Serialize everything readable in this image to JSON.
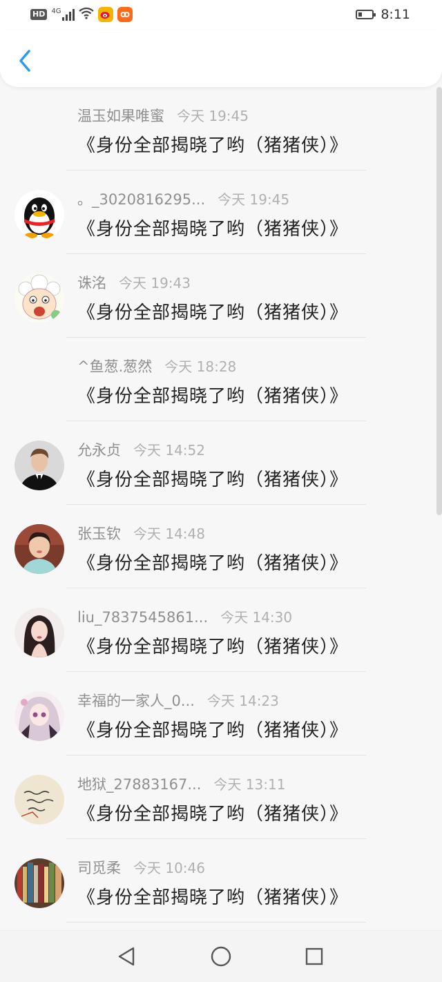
{
  "status_bar": {
    "hd": "HD",
    "network": "4G",
    "time": "8:11",
    "battery_level": 0.3
  },
  "header": {
    "back_icon": "chevron-left-icon",
    "accent_color": "#2b9de8"
  },
  "message_text": "《身份全部揭晓了哟（猪猪侠）》",
  "messages": [
    {
      "name": "温玉如果唯蜜",
      "time": "今天 19:45",
      "text": "《身份全部揭晓了哟（猪猪侠）》",
      "avatar": "none"
    },
    {
      "name": "。_3020816295...",
      "time": "今天 19:45",
      "text": "《身份全部揭晓了哟（猪猪侠）》",
      "avatar": "qq-penguin"
    },
    {
      "name": "诛洺",
      "time": "今天 19:43",
      "text": "《身份全部揭晓了哟（猪猪侠）》",
      "avatar": "cartoon-sheep"
    },
    {
      "name": "^鱼葱.葱然",
      "time": "今天 18:28",
      "text": "《身份全部揭晓了哟（猪猪侠）》",
      "avatar": "none"
    },
    {
      "name": "允永贞",
      "time": "今天 14:52",
      "text": "《身份全部揭晓了哟（猪猪侠）》",
      "avatar": "man-in-suit"
    },
    {
      "name": "张玉钦",
      "time": "今天 14:48",
      "text": "《身份全部揭晓了哟（猪猪侠）》",
      "avatar": "girl-photo"
    },
    {
      "name": "liu_7837545861...",
      "time": "今天 14:30",
      "text": "《身份全部揭晓了哟（猪猪侠）》",
      "avatar": "woman-photo"
    },
    {
      "name": "幸福的一家人_0...",
      "time": "今天 14:23",
      "text": "《身份全部揭晓了哟（猪猪侠）》",
      "avatar": "anime-girl"
    },
    {
      "name": "地狱_27883167...",
      "time": "今天 13:11",
      "text": "《身份全部揭晓了哟（猪猪侠）》",
      "avatar": "handwriting-note"
    },
    {
      "name": "司觅柔",
      "time": "今天 10:46",
      "text": "《身份全部揭晓了哟（猪猪侠）》",
      "avatar": "bookshelf"
    }
  ],
  "nav": {
    "back_icon": "triangle-back-icon",
    "home_icon": "circle-home-icon",
    "recents_icon": "square-recents-icon"
  }
}
